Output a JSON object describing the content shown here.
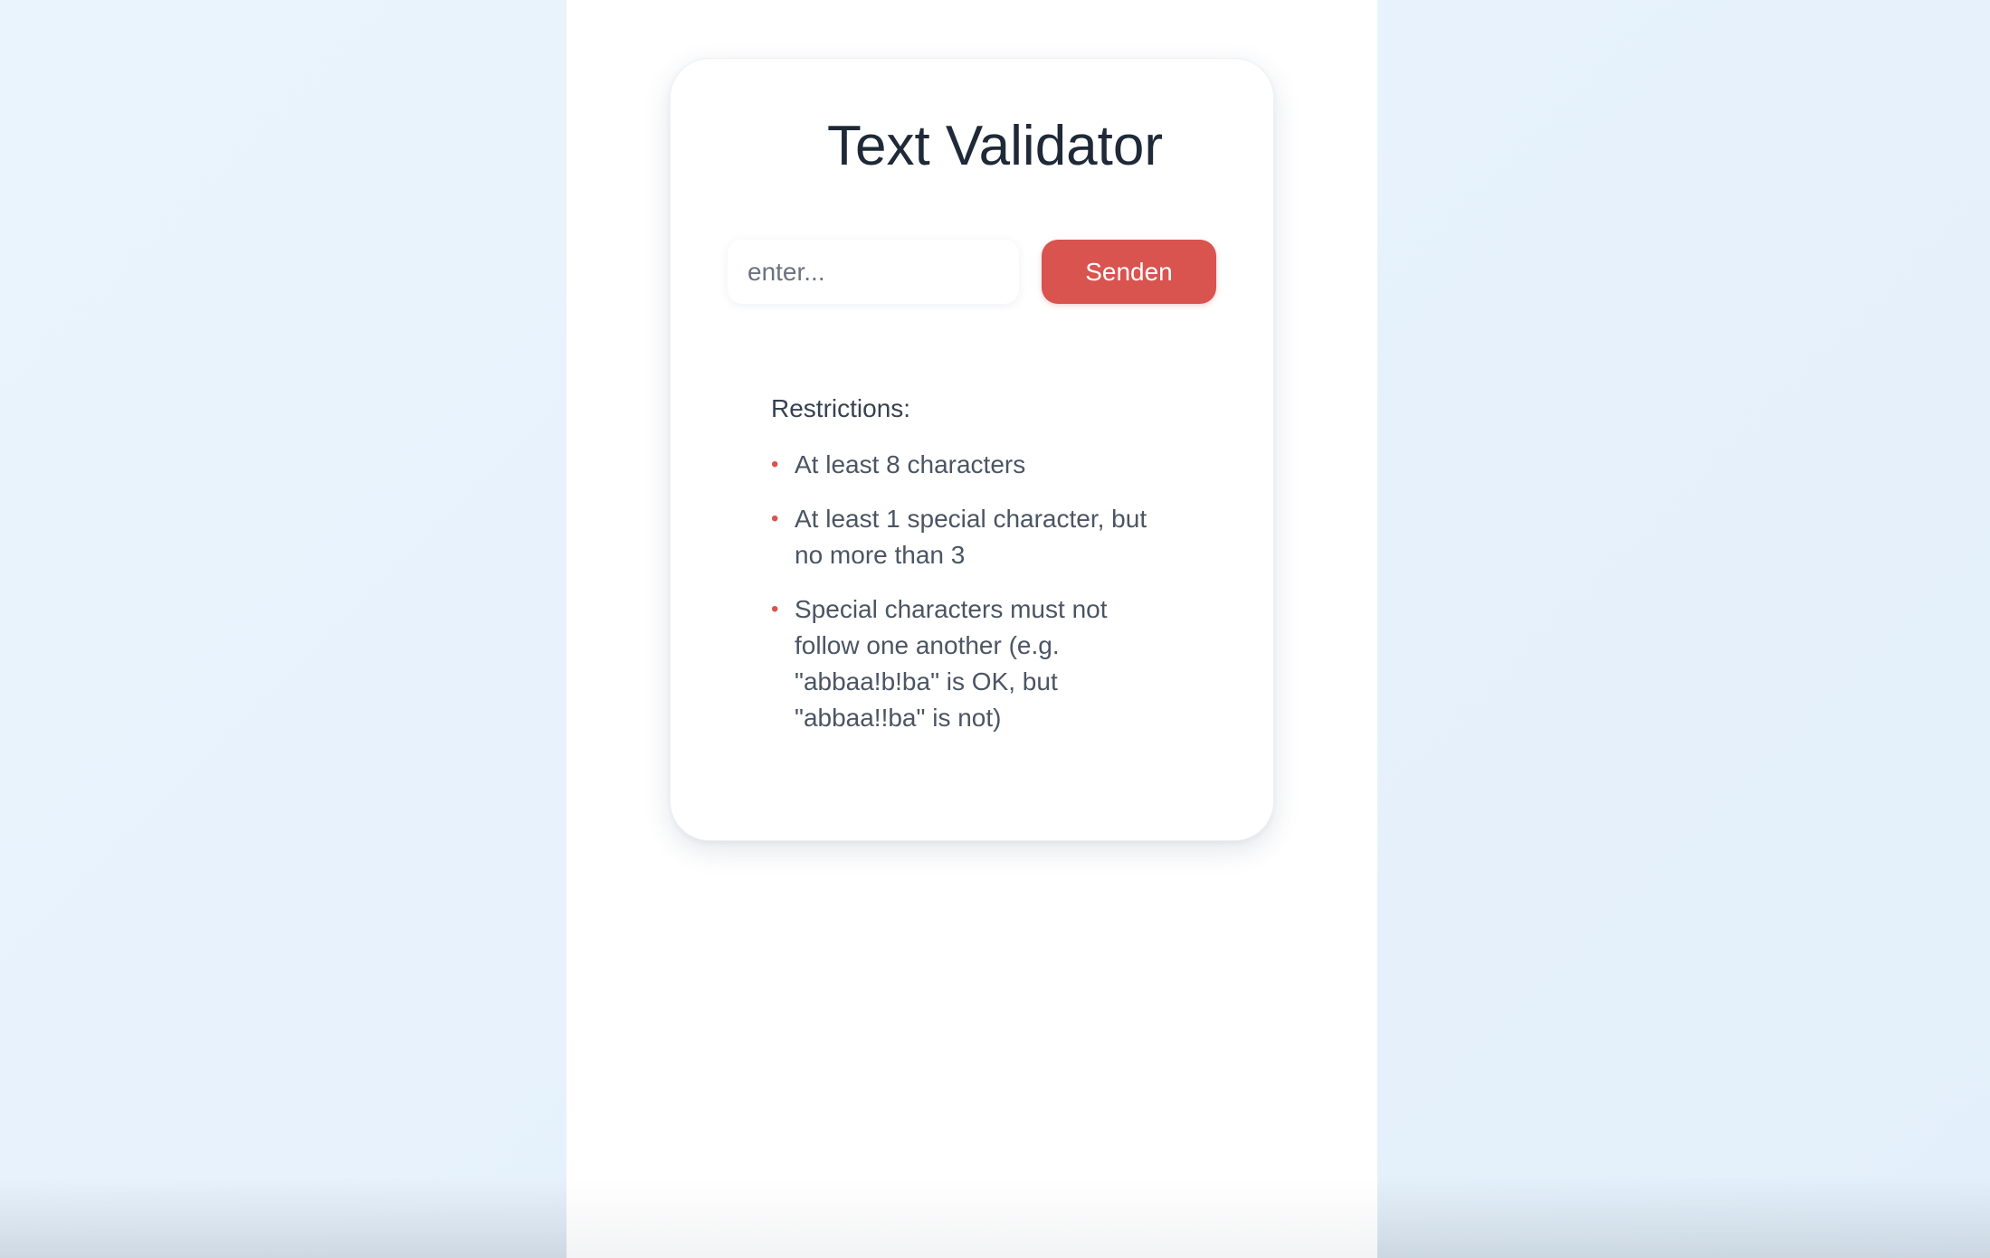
{
  "validator": {
    "title": "Text Validator",
    "input_placeholder": "enter...",
    "input_value": "",
    "submit_label": "Senden"
  },
  "restrictions": {
    "heading": "Restrictions:",
    "items": [
      "At least 8 characters",
      "At least 1 special character, but no more than 3",
      "Special characters must not follow one another (e.g. \"abbaa!b!ba\" is OK, but \"abbaa!!ba\" is not)"
    ],
    "bullet_glyph": "•"
  },
  "colors": {
    "accent": "#d9534f",
    "title_text": "#1f2937",
    "body_text": "#4b5563",
    "background": "#eaf4fd"
  }
}
